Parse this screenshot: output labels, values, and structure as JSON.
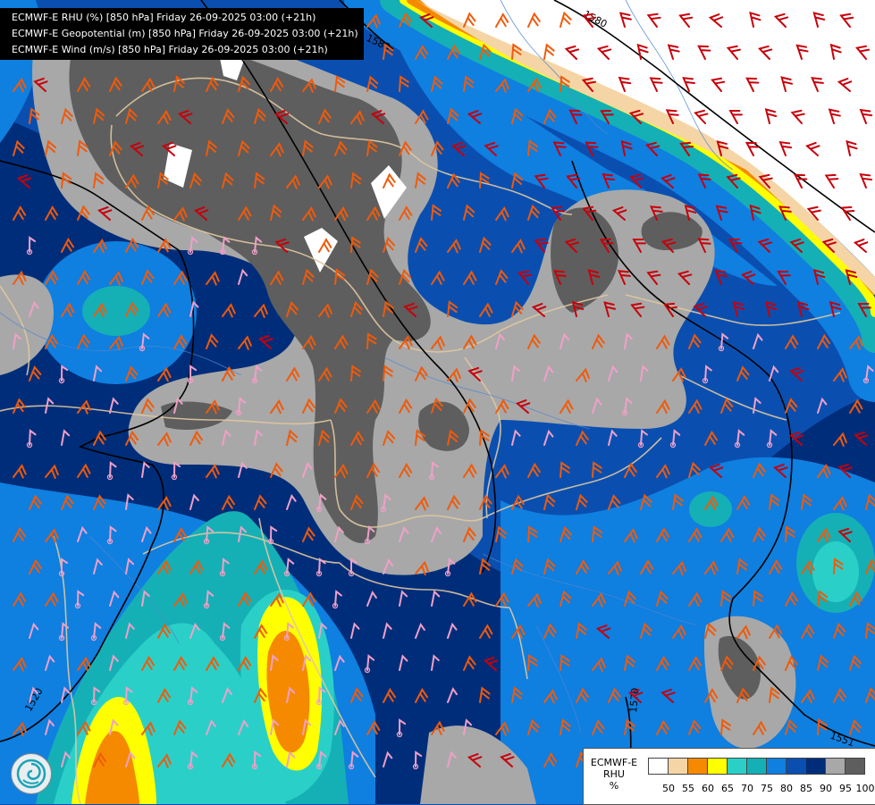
{
  "titles": [
    "ECMWF-E RHU (%) [850 hPa] Friday 26-09-2025 03:00 (+21h)",
    "ECMWF-E Geopotential (m) [850 hPa] Friday 26-09-2025 03:00 (+21h)",
    "ECMWF-E Wind (m/s) [850 hPa] Friday 26-09-2025 03:00 (+21h)"
  ],
  "contour_labels": [
    "1580",
    "1580",
    "1520",
    "1570",
    "1551"
  ],
  "legend": {
    "model": "ECMWF-E",
    "variable": "RHU",
    "unit": "%",
    "ticks": [
      "50",
      "55",
      "60",
      "65",
      "70",
      "75",
      "80",
      "85",
      "90",
      "95",
      "100"
    ],
    "colors": [
      "#ffffff",
      "#f5d5a5",
      "#f58a00",
      "#ffff00",
      "#2ad0c8",
      "#15b0b5",
      "#0f7fe0",
      "#0a4fb0",
      "#002d7a",
      "#a8a8a8",
      "#5e5e5e"
    ]
  },
  "colors": {
    "barb_low": "#f0a0c8",
    "barb_mid": "#f05a0a",
    "barb_high": "#c8000a",
    "border": "#e0c8a0",
    "geopotential": "#000000"
  },
  "logo_icon": "ecmwf-swirl-icon"
}
